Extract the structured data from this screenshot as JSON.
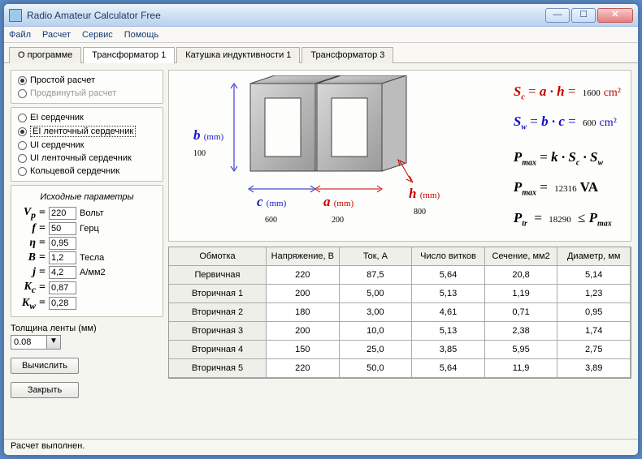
{
  "window_title": "Radio Amateur Calculator Free",
  "menubar": [
    "Файл",
    "Расчет",
    "Сервис",
    "Помощь"
  ],
  "tabs": [
    "О программе",
    "Трансформатор 1",
    "Катушка индуктивности 1",
    "Трансформатор 3"
  ],
  "active_tab": 1,
  "calc_type": {
    "simple": "Простой расчет",
    "advanced": "Продвинутый расчет"
  },
  "cores": {
    "ei": "EI сердечник",
    "ei_tape": "EI ленточный сердечник",
    "ui": "UI сердечник",
    "ui_tape": "UI ленточный сердечник",
    "ring": "Кольцевой сердечник"
  },
  "params_title": "Исходные параметры",
  "params": {
    "vp": {
      "sym": "Vₚ",
      "val": "220",
      "unit": "Вольт"
    },
    "f": {
      "sym": "f",
      "val": "50",
      "unit": "Герц"
    },
    "eta": {
      "sym": "η",
      "val": "0,95",
      "unit": ""
    },
    "b": {
      "sym": "B",
      "val": "1,2",
      "unit": "Тесла"
    },
    "j": {
      "sym": "j",
      "val": "4,2",
      "unit": "А/мм2"
    },
    "kc": {
      "sym": "Kc",
      "val": "0,87",
      "unit": ""
    },
    "kw": {
      "sym": "Kw",
      "val": "0,28",
      "unit": ""
    }
  },
  "tape_thickness_label": "Толщина ленты (мм)",
  "tape_thickness": "0.08",
  "btn_calc": "Вычислить",
  "btn_close": "Закрыть",
  "dims": {
    "b": {
      "val": "100"
    },
    "c": {
      "val": "600"
    },
    "a": {
      "val": "200"
    },
    "h": {
      "val": "800"
    }
  },
  "formulas": {
    "sc_val": "1600",
    "sw_val": "600",
    "pmax_val": "12316",
    "ptr_val": "18290"
  },
  "table": {
    "headers": [
      "Обмотка",
      "Напряжение, В",
      "Ток, А",
      "Число витков",
      "Сечение, мм2",
      "Диаметр, мм"
    ],
    "rows": [
      {
        "name": "Первичная",
        "v": "220",
        "i": "87,5",
        "n": "5,64",
        "s": "20,8",
        "d": "5,14"
      },
      {
        "name": "Вторичная 1",
        "v": "200",
        "i": "5,00",
        "n": "5,13",
        "s": "1,19",
        "d": "1,23"
      },
      {
        "name": "Вторичная 2",
        "v": "180",
        "i": "3,00",
        "n": "4,61",
        "s": "0,71",
        "d": "0,95"
      },
      {
        "name": "Вторичная 3",
        "v": "200",
        "i": "10,0",
        "n": "5,13",
        "s": "2,38",
        "d": "1,74"
      },
      {
        "name": "Вторичная 4",
        "v": "150",
        "i": "25,0",
        "n": "3,85",
        "s": "5,95",
        "d": "2,75"
      },
      {
        "name": "Вторичная 5",
        "v": "220",
        "i": "50,0",
        "n": "5,64",
        "s": "11,9",
        "d": "3,89"
      }
    ]
  },
  "status": "Расчет выполнен."
}
